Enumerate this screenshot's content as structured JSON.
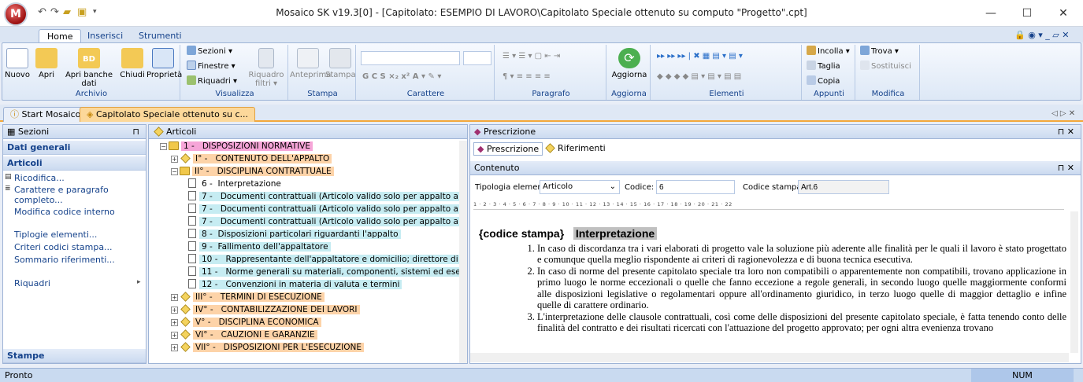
{
  "window": {
    "title": "Mosaico SK v19.3[0] - [Capitolato: ESEMPIO DI LAVORO\\Capitolato Speciale ottenuto su computo \"Progetto\".cpt]",
    "orb_letter": "M",
    "minimize": "—",
    "maximize": "☐",
    "close": "✕"
  },
  "ribbon_tabs": [
    "Home",
    "Inserisci",
    "Strumenti"
  ],
  "ribbon_right": "🔒 ◉ ▾ _ ▱ ✕",
  "groups": {
    "archivio": {
      "label": "Archivio",
      "buttons": [
        "Nuovo",
        "Apri",
        "Apri banche dati",
        "Chiudi",
        "Proprietà"
      ],
      "bd_badge": "BD"
    },
    "visualizza": {
      "label": "Visualizza",
      "sezioni": "Sezioni ▾",
      "finestre": "Finestre ▾",
      "riquadri": "Riquadri ▾",
      "filtri": "Riquadro filtri ▾"
    },
    "stampa": {
      "label": "Stampa",
      "buttons": [
        "Anteprima",
        "Stampa"
      ]
    },
    "carattere": {
      "label": "Carattere",
      "format_buttons": "G  C  S  ×₂  x²  A ▾  ✎ ▾"
    },
    "paragrafo": {
      "label": "Paragrafo"
    },
    "aggiorna": {
      "label": "Aggiorna",
      "button": "Aggiorna"
    },
    "elementi": {
      "label": "Elementi"
    },
    "appunti": {
      "label": "Appunti",
      "incolla": "Incolla ▾",
      "taglia": "Taglia",
      "copia": "Copia"
    },
    "modifica": {
      "label": "Modifica",
      "trova": "Trova ▾",
      "sostituisci": "Sostituisci"
    }
  },
  "doc_tabs": [
    "Start Mosaico",
    "Capitolato Speciale ottenuto su c..."
  ],
  "doc_tabs_right": "◁ ▷ ✕",
  "sidebar": {
    "header": "Sezioni",
    "pin": "⊓",
    "sections": [
      "Dati generali",
      "Articoli"
    ],
    "links": [
      "Ricodifica...",
      "Carattere e paragrafo completo...",
      "Modifica codice interno"
    ],
    "links2": [
      "Tiplogie elementi...",
      "Criteri codici stampa...",
      "Sommario riferimenti..."
    ],
    "riquadri": "Riquadri",
    "stampe": "Stampe"
  },
  "tree": {
    "header": "Articoli",
    "rows": [
      {
        "num": "1 -",
        "text": "DISPOSIZIONI NORMATIVE"
      },
      {
        "num": "I° -",
        "text": "CONTENUTO DELL'APPALTO"
      },
      {
        "num": "II° -",
        "text": "DISCIPLINA CONTRATTUALE"
      },
      {
        "num": "6 -",
        "text": "Interpretazione"
      },
      {
        "num": "7 -",
        "text": "Documenti contrattuali  (Articolo valido solo per appalto a MISUR"
      },
      {
        "num": "7 -",
        "text": "Documenti contrattuali  (Articolo valido solo per appalto a CORP"
      },
      {
        "num": "7 -",
        "text": "Documenti contrattuali  (Articolo valido solo per appalto a CORP"
      },
      {
        "num": "8 -",
        "text": "Disposizioni particolari riguardanti l'appalto"
      },
      {
        "num": "9 -",
        "text": "Fallimento dell'appaltatore"
      },
      {
        "num": "10 -",
        "text": "Rappresentante dell'appaltatore e domicilio; direttore di cantiere"
      },
      {
        "num": "11 -",
        "text": "Norme generali su materiali, componenti, sistemi ed esecuzione"
      },
      {
        "num": "12 -",
        "text": "Convenzioni in materia di valuta e termini"
      },
      {
        "num": "III° -",
        "text": "TERMINI DI ESECUZIONE"
      },
      {
        "num": "IV° -",
        "text": "CONTABILIZZAZIONE DEI LAVORI"
      },
      {
        "num": "V° -",
        "text": "DISCIPLINA ECONOMICA"
      },
      {
        "num": "VI° -",
        "text": "CAUZIONI E GARANZIE"
      },
      {
        "num": "VII° -",
        "text": "DISPOSIZIONI PER L'ESECUZIONE"
      }
    ]
  },
  "prescrizione": {
    "header": "Prescrizione",
    "pin": "⊓ ✕",
    "tabs": [
      "Prescrizione",
      "Riferimenti"
    ],
    "contenuto": "Contenuto",
    "tipologia_label": "Tipologia elemento:",
    "tipologia_value": "Articolo",
    "codice_label": "Codice:",
    "codice_value": "6",
    "codice_stampa_label": "Codice stampa:",
    "codice_stampa_value": "Art.6",
    "ruler": "1 · 2 · 3 · 4 · 5 · 6 · 7 · 8 · 9 · 10 · 11 · 12 · 13 · 14 · 15 · 16 · 17 · 18 · 19 · 20 · 21 · 22",
    "doc_code": "{codice stampa}",
    "doc_title": "Interpretazione",
    "paragraphs": [
      "In caso di discordanza tra i vari elaborati di progetto vale la soluzione più aderente alle finalità per le quali il lavoro è stato progettato e comunque quella meglio rispondente ai criteri di ragionevolezza e di buona tecnica esecutiva.",
      "In caso di norme del presente capitolato speciale tra loro non compatibili o apparentemente non compatibili, trovano applicazione in primo luogo le norme eccezionali o quelle che fanno eccezione a regole generali, in secondo luogo quelle maggiormente conformi alle disposizioni legislative o regolamentari oppure all'ordinamento giuridico, in terzo luogo quelle di maggior dettaglio e infine quelle di carattere ordinario.",
      "L'interpretazione delle clausole contrattuali, così come delle disposizioni del presente capitolato speciale, è fatta tenendo conto delle finalità del contratto e dei risultati ricercati con l'attuazione del progetto approvato; per ogni altra evenienza trovano"
    ]
  },
  "status": {
    "left": "Pronto",
    "right": "NUM"
  },
  "colors": {
    "accent": "#f4a83a",
    "ribbon_blue": "#15428b",
    "pink": "#f6a5d8",
    "orange": "#fdd3a8",
    "cyan": "#c6ecf2"
  }
}
